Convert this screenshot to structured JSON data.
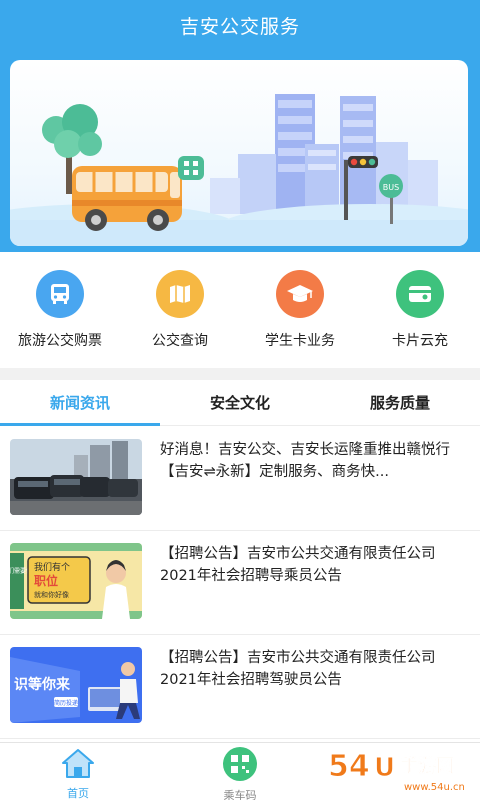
{
  "header": {
    "title": "吉安公交服务"
  },
  "banner": {
    "bus_sign": "BUS"
  },
  "services": [
    {
      "label": "旅游公交购票",
      "icon": "bus-icon",
      "color": "#49a6f0"
    },
    {
      "label": "公交查询",
      "icon": "map-icon",
      "color": "#f6b843"
    },
    {
      "label": "学生卡业务",
      "icon": "graduation-cap-icon",
      "color": "#f37b47"
    },
    {
      "label": "卡片云充",
      "icon": "card-icon",
      "color": "#3ec27d"
    }
  ],
  "tabs": [
    {
      "label": "新闻资讯",
      "active": true
    },
    {
      "label": "安全文化",
      "active": false
    },
    {
      "label": "服务质量",
      "active": false
    }
  ],
  "news": [
    {
      "title": "好消息！吉安公交、吉安长运隆重推出赣悦行【吉安⇌永新】定制服务、商务快..."
    },
    {
      "title": "【招聘公告】吉安市公共交通有限责任公司2021年社会招聘导乘员公告",
      "thumb_text": [
        "我们有个",
        "职位",
        "就和你好像",
        "我们需要你"
      ]
    },
    {
      "title": "【招聘公告】吉安市公共交通有限责任公司2021年社会招聘驾驶员公告",
      "thumb_text": [
        "识等你来",
        "简历投递"
      ]
    }
  ],
  "tabbar": {
    "items": [
      {
        "label": "首页",
        "icon": "home-icon",
        "active": true
      },
      {
        "label": "乘车码",
        "icon": "qr-code-icon",
        "active": false
      }
    ]
  },
  "watermark": {
    "text": "54U手游网",
    "sub": "www.54u.cn"
  },
  "colors": {
    "primary": "#3aa8ec",
    "divider": "#ececec"
  }
}
